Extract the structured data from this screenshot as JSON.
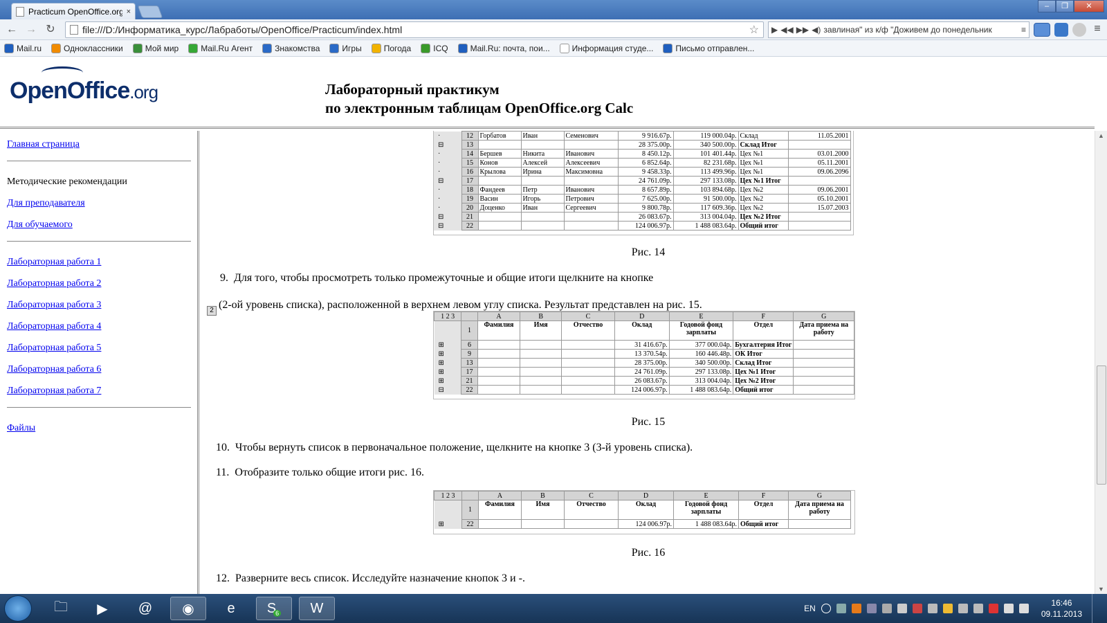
{
  "browser": {
    "tab_title": "Practicum OpenOffice.org",
    "tab_close": "×",
    "url": "file:///D:/Информатика_курс/Лабработы/OpenOffice/Practicum/index.html",
    "media_ticker": "завлиная\" из к/ф \"Доживем до понедельник",
    "extension_badge": "51"
  },
  "bookmarks": [
    {
      "label": "Mail.ru",
      "color": "#1f5fbf"
    },
    {
      "label": "Одноклассники",
      "color": "#f18b00"
    },
    {
      "label": "Мой мир",
      "color": "#3a8f3a"
    },
    {
      "label": "Mail.Ru Агент",
      "color": "#36a836"
    },
    {
      "label": "Знакомства",
      "color": "#2a6ac7"
    },
    {
      "label": "Игры",
      "color": "#2a6ac7"
    },
    {
      "label": "Погода",
      "color": "#f2b300"
    },
    {
      "label": "ICQ",
      "color": "#3a9a2a"
    },
    {
      "label": "Mail.Ru: почта, пои...",
      "color": "#1f5fbf"
    },
    {
      "label": "Информация студе...",
      "color": "#ffffff"
    },
    {
      "label": "Письмо отправлен...",
      "color": "#1f5fbf"
    }
  ],
  "header": {
    "logo_main": "OpenOffice",
    "logo_org": ".org",
    "title_line1": "Лабораторный практикум",
    "title_line2": "по электронным таблицам OpenOffice.org Calc"
  },
  "sidebar": {
    "home": "Главная страница",
    "methodical": "Методические рекомендации",
    "for_teacher": "Для преподавателя",
    "for_student": "Для обучаемого",
    "labs": [
      "Лабораторная работа 1",
      "Лабораторная работа 2",
      "Лабораторная работа 3",
      "Лабораторная работа 4",
      "Лабораторная работа 5",
      "Лабораторная работа 6",
      "Лабораторная работа 7"
    ],
    "files": "Файлы"
  },
  "content": {
    "fig14_caption": "Рис. 14",
    "step9_num": "9.",
    "step9_text": "Для того, чтобы просмотреть только промежуточные и общие итоги щелкните на кнопке",
    "level2_btn": "2",
    "step9_cont": "(2-ой уровень списка), расположенной в верхнем левом углу списка. Результат представлен на рис. 15.",
    "fig15_caption": "Рис. 15",
    "step10_num": "10.",
    "step10_text": "Чтобы вернуть список в первоначальное положение, щелкните на кнопке 3 (3-й уровень списка).",
    "step11_num": "11.",
    "step11_text": "Отобразите только общие итоги рис. 16.",
    "fig16_caption": "Рис. 16",
    "step12_num": "12.",
    "step12_text": "Разверните весь список. Исследуйте назначение кнопок 3 и -."
  },
  "fig14": {
    "rows": [
      {
        "n": "12",
        "f": "Горбатов",
        "i": "Иван",
        "o": "Семенович",
        "d": "9 916.67р.",
        "e": "119 000.04р.",
        "g": "Склад",
        "h": "11.05.2001",
        "bold": false
      },
      {
        "n": "13",
        "f": "",
        "i": "",
        "o": "",
        "d": "28 375.00р.",
        "e": "340 500.00р.",
        "g": "Склад Итог",
        "h": "",
        "bold": true
      },
      {
        "n": "14",
        "f": "Бершев",
        "i": "Никита",
        "o": "Иванович",
        "d": "8 450.12р.",
        "e": "101 401.44р.",
        "g": "Цех №1",
        "h": "03.01.2000",
        "bold": false
      },
      {
        "n": "15",
        "f": "Конов",
        "i": "Алексей",
        "o": "Алексеевич",
        "d": "6 852.64р.",
        "e": "82 231.68р.",
        "g": "Цех №1",
        "h": "05.11.2001",
        "bold": false
      },
      {
        "n": "16",
        "f": "Крылова",
        "i": "Ирина",
        "o": "Максимовна",
        "d": "9 458.33р.",
        "e": "113 499.96р.",
        "g": "Цех №1",
        "h": "09.06.2096",
        "bold": false
      },
      {
        "n": "17",
        "f": "",
        "i": "",
        "o": "",
        "d": "24 761.09р.",
        "e": "297 133.08р.",
        "g": "Цех №1 Итог",
        "h": "",
        "bold": true
      },
      {
        "n": "18",
        "f": "Фандеев",
        "i": "Петр",
        "o": "Иванович",
        "d": "8 657.89р.",
        "e": "103 894.68р.",
        "g": "Цех №2",
        "h": "09.06.2001",
        "bold": false
      },
      {
        "n": "19",
        "f": "Васин",
        "i": "Игорь",
        "o": "Петрович",
        "d": "7 625.00р.",
        "e": "91 500.00р.",
        "g": "Цех №2",
        "h": "05.10.2001",
        "bold": false
      },
      {
        "n": "20",
        "f": "Доценко",
        "i": "Иван",
        "o": "Сергеевич",
        "d": "9 800.78р.",
        "e": "117 609.36р.",
        "g": "Цех №2",
        "h": "15.07.2003",
        "bold": false
      },
      {
        "n": "21",
        "f": "",
        "i": "",
        "o": "",
        "d": "26 083.67р.",
        "e": "313 004.04р.",
        "g": "Цех №2 Итог",
        "h": "",
        "bold": true
      },
      {
        "n": "22",
        "f": "",
        "i": "",
        "o": "",
        "d": "124 006.97р.",
        "e": "1 488 083.64р.",
        "g": "Общий итог",
        "h": "",
        "bold": true
      }
    ]
  },
  "sheet_headers": {
    "levels": "1 2 3",
    "cols": [
      "A",
      "B",
      "C",
      "D",
      "E",
      "F",
      "G"
    ],
    "h_fam": "Фамилия",
    "h_name": "Имя",
    "h_otch": "Отчество",
    "h_oklad": "Оклад",
    "h_fond": "Годовой фонд зарплаты",
    "h_otdel": "Отдел",
    "h_date": "Дата приема на работу",
    "row1": "1"
  },
  "fig15": {
    "rows": [
      {
        "n": "6",
        "d": "31 416.67р.",
        "e": "377 000.04р.",
        "g": "Бухгалтерия Итог"
      },
      {
        "n": "9",
        "d": "13 370.54р.",
        "e": "160 446.48р.",
        "g": "ОК Итог"
      },
      {
        "n": "13",
        "d": "28 375.00р.",
        "e": "340 500.00р.",
        "g": "Склад Итог"
      },
      {
        "n": "17",
        "d": "24 761.09р.",
        "e": "297 133.08р.",
        "g": "Цех №1 Итог"
      },
      {
        "n": "21",
        "d": "26 083.67р.",
        "e": "313 004.04р.",
        "g": "Цех №2 Итог"
      },
      {
        "n": "22",
        "d": "124 006.97р.",
        "e": "1 488 083.64р.",
        "g": "Общий итог"
      }
    ]
  },
  "fig16": {
    "row": {
      "n": "22",
      "d": "124 006.97р.",
      "e": "1 488 083.64р.",
      "g": "Общий итог"
    }
  },
  "taskbar": {
    "lang": "EN",
    "time": "16:46",
    "date": "09.11.2013",
    "skype_badge": "6"
  }
}
